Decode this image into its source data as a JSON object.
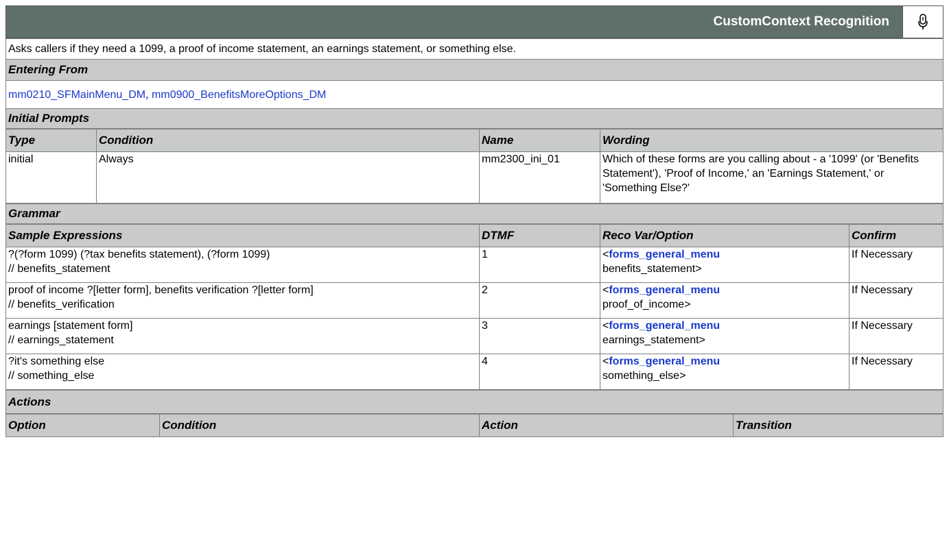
{
  "header": {
    "title": "CustomContext Recognition",
    "icon": "microphone-icon"
  },
  "description": "Asks callers if they need a 1099, a proof of income statement, an earnings statement, or something else.",
  "entering_from": {
    "label": "Entering From",
    "links": [
      "mm0210_SFMainMenu_DM",
      "mm0900_BenefitsMoreOptions_DM"
    ],
    "separator": ","
  },
  "initial_prompts": {
    "label": "Initial Prompts",
    "columns": {
      "type": "Type",
      "condition": "Condition",
      "name": "Name",
      "wording": "Wording"
    },
    "rows": [
      {
        "type": "initial",
        "condition": "Always",
        "name": "mm2300_ini_01",
        "wording": "Which of these forms are you calling about - a '1099' (or 'Benefits Statement'), 'Proof of Income,' an 'Earnings Statement,' or 'Something Else?'"
      }
    ]
  },
  "grammar": {
    "label": "Grammar",
    "columns": {
      "sample": "Sample Expressions",
      "dtmf": "DTMF",
      "reco": "Reco Var/Option",
      "confirm": "Confirm"
    },
    "rows": [
      {
        "sample_line1": "?(?form 1099) (?tax benefits statement), (?form 1099)",
        "sample_line2": "// benefits_statement",
        "dtmf": "1",
        "reco_open": "<",
        "reco_var": "forms_general_menu",
        "reco_option": "benefits_statement>",
        "confirm": "If Necessary"
      },
      {
        "sample_line1": "proof of income ?[letter form], benefits verification ?[letter form]",
        "sample_line2": "// benefits_verification",
        "dtmf": "2",
        "reco_open": "<",
        "reco_var": "forms_general_menu",
        "reco_option": "proof_of_income>",
        "confirm": "If Necessary"
      },
      {
        "sample_line1": "earnings [statement form]",
        "sample_line2": "// earnings_statement",
        "dtmf": "3",
        "reco_open": "<",
        "reco_var": "forms_general_menu",
        "reco_option": "earnings_statement>",
        "confirm": "If Necessary"
      },
      {
        "sample_line1": "?it's something else",
        "sample_line2": "// something_else",
        "dtmf": "4",
        "reco_open": "<",
        "reco_var": "forms_general_menu",
        "reco_option": "something_else>",
        "confirm": "If Necessary"
      }
    ]
  },
  "actions": {
    "label": "Actions",
    "columns": {
      "option": "Option",
      "condition": "Condition",
      "action": "Action",
      "transition": "Transition"
    }
  }
}
